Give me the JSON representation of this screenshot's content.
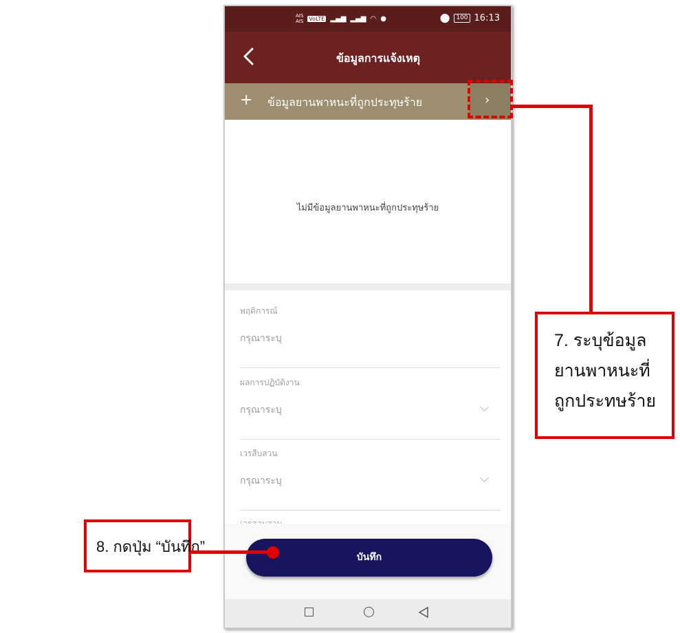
{
  "statusbar": {
    "carrier_top": "AIS",
    "carrier_bottom": "AIS",
    "volte": "VoLTE",
    "battery": "100",
    "time": "16:13"
  },
  "appbar": {
    "title": "ข้อมูลการแจ้งเหตุ"
  },
  "vehicle_section": {
    "add_symbol": "+",
    "title": "ข้อมูลยานพาหนะที่ถูกประทุษร้าย",
    "chevron": "›",
    "empty_message": "ไม่มีข้อมูลยานพาหนะที่ถูกประทุษร้าย"
  },
  "form": {
    "fields": [
      {
        "label": "พฤติการณ์",
        "placeholder": "กรุณาระบุ"
      },
      {
        "label": "ผลการปฏิบัติงาน",
        "placeholder": "กรุณาระบุ"
      },
      {
        "label": "เวรสืบสวน",
        "placeholder": "กรุณาระบุ"
      }
    ],
    "partial_label": "เวรสอบสวน"
  },
  "save_button": {
    "label": "บันทึก"
  },
  "annotations": {
    "step7": [
      "7. ระบุข้อมูล",
      "ยานพาหนะที่",
      "ถูกประทษร้าย"
    ],
    "step8": "8. กดปุ่ม “บันทึก”"
  },
  "colors": {
    "statusbar": "#5b1c1c",
    "appbar": "#6d2121",
    "section_header": "#9c8e6e",
    "save_button": "#171560",
    "annotation_red": "#e00000"
  }
}
